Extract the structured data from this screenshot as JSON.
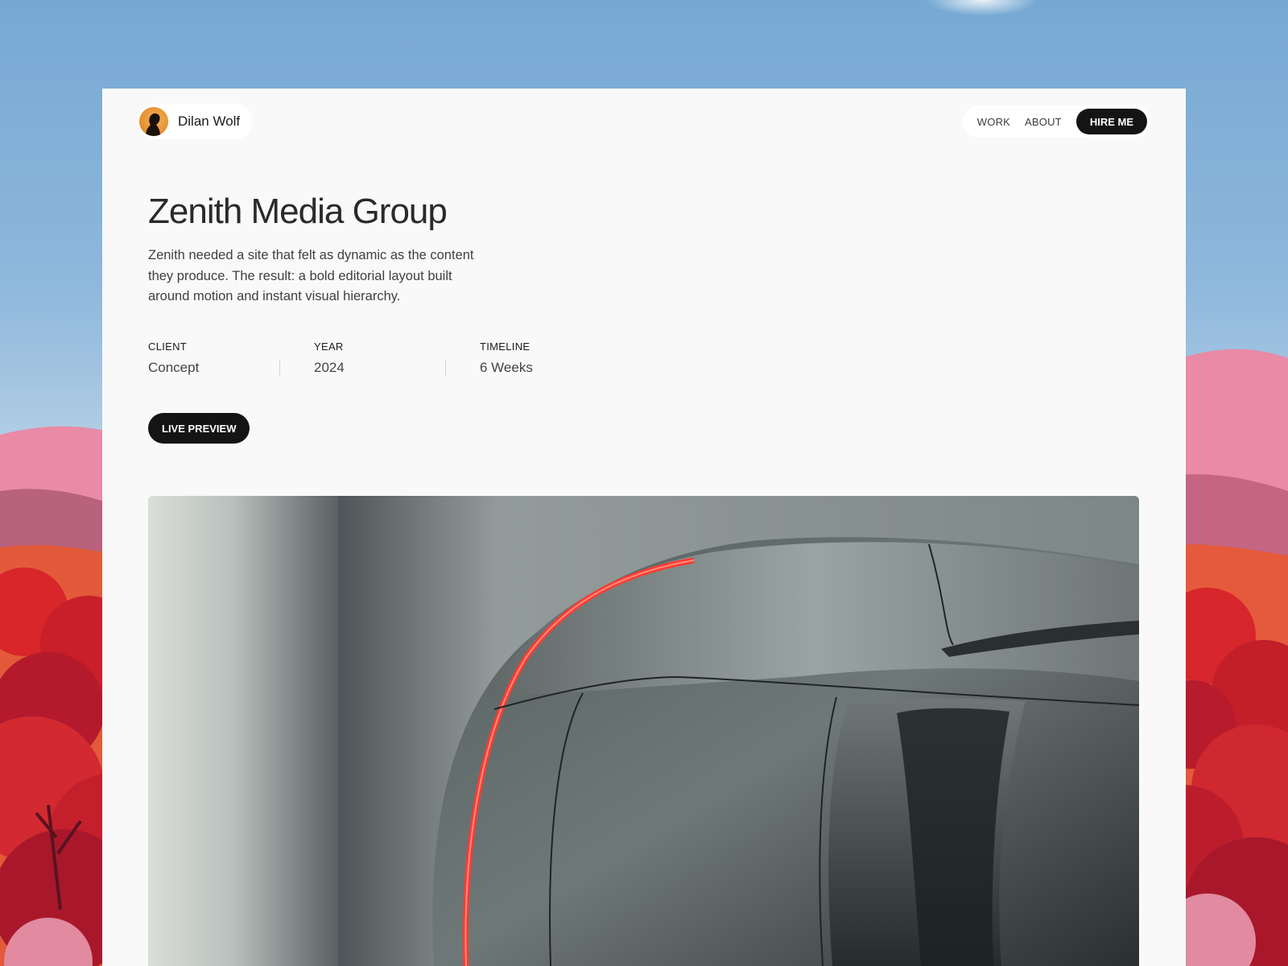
{
  "header": {
    "brand_name": "Dilan Wolf",
    "nav": [
      {
        "label": "WORK"
      },
      {
        "label": "ABOUT"
      }
    ],
    "cta_label": "HIRE ME"
  },
  "project": {
    "title": "Zenith Media Group",
    "description": "Zenith needed a site that felt as dynamic as the content they produce. The result: a bold editorial layout built around motion and instant visual hierarchy.",
    "meta": [
      {
        "label": "CLIENT",
        "value": "Concept"
      },
      {
        "label": "YEAR",
        "value": "2024"
      },
      {
        "label": "TIMELINE",
        "value": "6 Weeks"
      }
    ],
    "preview_label": "LIVE PREVIEW"
  },
  "colors": {
    "accent": "#141414",
    "card_bg": "#f9f9f9",
    "tail_light": "#ff3b30"
  },
  "icons": {
    "avatar": "person-silhouette-avatar"
  }
}
